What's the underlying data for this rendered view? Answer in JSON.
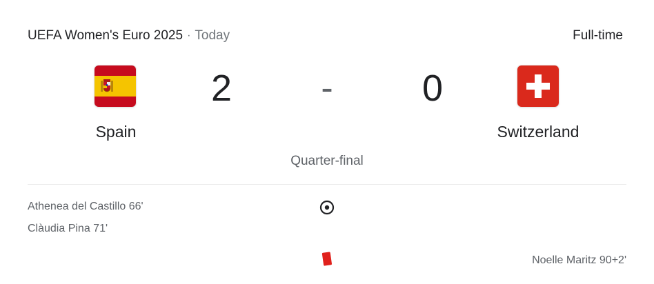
{
  "match": {
    "competition": "UEFA Women's Euro 2025",
    "separator": "·",
    "day": "Today",
    "status": "Full-time",
    "stage": "Quarter-final"
  },
  "home": {
    "name": "Spain",
    "score": "2",
    "flag_icon": "spain-flag-icon"
  },
  "away": {
    "name": "Switzerland",
    "score": "0",
    "flag_icon": "switzerland-flag-icon"
  },
  "score_separator": "-",
  "events": [
    {
      "side": "home",
      "type": "goal",
      "icon": "soccer-ball-icon",
      "text": "Athenea del Castillo 66'"
    },
    {
      "side": "home",
      "type": "goal",
      "text": "Clàudia Pina 71'"
    },
    {
      "side": "away",
      "type": "red-card",
      "icon": "red-card-icon",
      "text": "Noelle Maritz 90+2'"
    }
  ],
  "colors": {
    "spain_red": "#c60b1e",
    "spain_yellow": "#f5c400",
    "swiss_red": "#da291c",
    "red_card": "#e0211c"
  }
}
